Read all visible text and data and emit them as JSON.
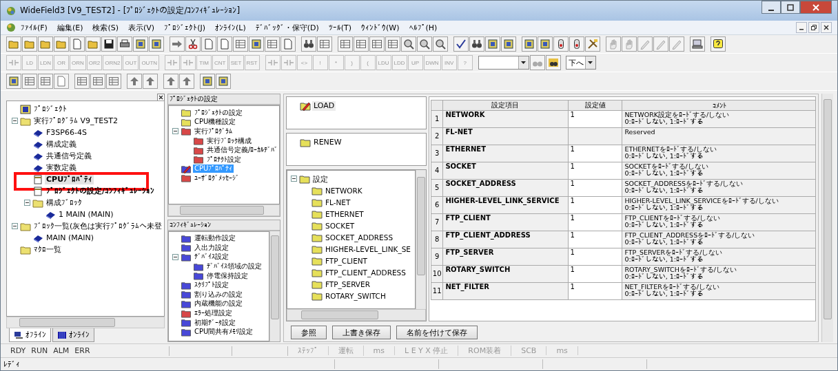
{
  "window": {
    "title": "WideField3 [V9_TEST2] - [ﾌﾟﾛｼﾞｪｸﾄの設定/ｺﾝﾌｨｷﾞｭﾚｰｼｮﾝ]"
  },
  "menu": [
    "ﾌｧｲﾙ(F)",
    "編集(E)",
    "検索(S)",
    "表示(V)",
    "ﾌﾟﾛｼﾞｪｸﾄ(J)",
    "ｵﾝﾗｲﾝ(L)",
    "ﾃﾞﾊﾞｯｸﾞ・保守(D)",
    "ﾂｰﾙ(T)",
    "ｳｨﾝﾄﾞｳ(W)",
    "ﾍﾙﾌﾟ(H)"
  ],
  "instruction_toolbar": [
    [
      {
        "kind": "icon",
        "disabled": true
      },
      {
        "kind": "text",
        "label": "LD",
        "disabled": true
      },
      {
        "kind": "text",
        "label": "LDN",
        "disabled": true
      },
      {
        "kind": "text",
        "label": "OR",
        "disabled": true
      },
      {
        "kind": "text",
        "label": "ORN",
        "disabled": true
      },
      {
        "kind": "text",
        "label": "OR2",
        "disabled": true
      },
      {
        "kind": "text",
        "label": "ORN2",
        "disabled": true
      },
      {
        "kind": "text",
        "label": "OUT",
        "disabled": true
      },
      {
        "kind": "text",
        "label": "OUTN",
        "disabled": true
      }
    ],
    [
      {
        "kind": "icon",
        "disabled": true
      },
      {
        "kind": "icon",
        "disabled": true
      },
      {
        "kind": "text",
        "label": "TIM",
        "disabled": true
      },
      {
        "kind": "text",
        "label": "CNT",
        "disabled": true
      },
      {
        "kind": "text",
        "label": "SET",
        "disabled": true
      },
      {
        "kind": "text",
        "label": "RST",
        "disabled": true
      }
    ],
    [
      {
        "kind": "icon",
        "disabled": true
      },
      {
        "kind": "icon",
        "disabled": true
      },
      {
        "kind": "text",
        "label": "<>",
        "disabled": true
      },
      {
        "kind": "text",
        "label": "!",
        "disabled": true
      },
      {
        "kind": "text",
        "label": "*",
        "disabled": true
      },
      {
        "kind": "text",
        "label": ")",
        "disabled": true
      },
      {
        "kind": "text",
        "label": "(",
        "disabled": true
      },
      {
        "kind": "text",
        "label": "LDU",
        "disabled": true
      },
      {
        "kind": "text",
        "label": "LDD",
        "disabled": true
      },
      {
        "kind": "text",
        "label": "UP",
        "disabled": true
      },
      {
        "kind": "text",
        "label": "DWN",
        "disabled": true
      },
      {
        "kind": "text",
        "label": "INV",
        "disabled": true
      },
      {
        "kind": "text",
        "label": "?",
        "disabled": true
      }
    ]
  ],
  "find": {
    "direction": "下へ"
  },
  "project_tree": {
    "items": [
      {
        "label": "ﾌﾟﾛｼﾞｪｸﾄ",
        "kind": "project",
        "bold": false,
        "selected": false,
        "marked": false
      },
      {
        "label": "実行ﾌﾟﾛｸﾞﾗﾑ V9_TEST2",
        "kind": "folder",
        "bold": false,
        "selected": false,
        "marked": false,
        "expanded": true,
        "children": [
          {
            "label": "F3SP66-4S",
            "kind": "book",
            "bold": false,
            "selected": false,
            "marked": false
          },
          {
            "label": "構成定義",
            "kind": "book",
            "bold": false,
            "selected": false,
            "marked": false
          },
          {
            "label": "共通信号定義",
            "kind": "book",
            "bold": false,
            "selected": false,
            "marked": false
          },
          {
            "label": "実数定義",
            "kind": "book",
            "bold": false,
            "selected": false,
            "marked": false
          },
          {
            "label": "CPUﾌﾟﾛﾊﾟﾃｨ",
            "kind": "doc",
            "bold": true,
            "selected": true,
            "marked": true
          },
          {
            "label": "ﾌﾟﾛｼﾞｪｸﾄの設定/ｺﾝﾌｨｷﾞｭﾚｰｼｮﾝ",
            "kind": "doc",
            "bold": true,
            "selected": false,
            "marked": false
          },
          {
            "label": "構成ﾌﾞﾛｯｸ",
            "kind": "folder",
            "bold": false,
            "selected": false,
            "marked": false,
            "expanded": true,
            "children": [
              {
                "label": "1 MAIN (MAIN)",
                "kind": "book",
                "bold": false,
                "selected": false,
                "marked": false
              }
            ]
          }
        ]
      },
      {
        "label": "ﾌﾞﾛｯｸ一覧(灰色は実行ﾌﾟﾛｸﾞﾗﾑへ未登",
        "kind": "folder",
        "bold": false,
        "selected": false,
        "marked": false,
        "expanded": true,
        "children": [
          {
            "label": "MAIN (MAIN)",
            "kind": "book",
            "bold": false,
            "selected": false,
            "marked": false
          }
        ]
      },
      {
        "label": "ﾏｸﾛ一覧",
        "kind": "folder",
        "bold": false,
        "selected": false,
        "marked": false
      }
    ]
  },
  "project_tabs": [
    {
      "label": "ｵﾌﾗｲﾝ",
      "selected": true
    },
    {
      "label": "ｵﾝﾗｲﾝ",
      "selected": false
    }
  ],
  "settings_panel": {
    "title": "ﾌﾟﾛｼﾞｪｸﾄの設定",
    "items": [
      {
        "label": "ﾌﾟﾛｼﾞｪｸﾄの設定",
        "kind": "folder",
        "color": "#e6e05a",
        "selected": false
      },
      {
        "label": "CPU機種設定",
        "kind": "folder",
        "color": "#e6e05a",
        "selected": false
      },
      {
        "label": "実行ﾌﾟﾛｸﾞﾗﾑ",
        "kind": "folder",
        "color": "#d84848",
        "selected": false,
        "expanded": true,
        "children": [
          {
            "label": "実行ﾌﾞﾛｯｸ構成",
            "kind": "folder",
            "color": "#d84848",
            "selected": false
          },
          {
            "label": "共通信号定義/ﾛｰｶﾙﾃﾞﾊﾞ",
            "kind": "folder",
            "color": "#d84848",
            "selected": false
          },
          {
            "label": "ﾌﾟﾛﾃｸﾄ設定",
            "kind": "folder",
            "color": "#d84848",
            "selected": false
          }
        ]
      },
      {
        "label": "CPUﾌﾟﾛﾊﾟﾃｨ",
        "kind": "pencil",
        "color": "#4848d8",
        "selected": true
      },
      {
        "label": "ﾕｰｻﾞﾛｸﾞﾒｯｾｰｼﾞ",
        "kind": "folder",
        "color": "#d84848",
        "selected": false
      }
    ]
  },
  "config_panel": {
    "title": "ｺﾝﾌｨｷﾞｭﾚｰｼｮﾝ",
    "items": [
      {
        "label": "運転動作設定",
        "kind": "folder",
        "color": "#4848d8",
        "selected": false
      },
      {
        "label": "入出力設定",
        "kind": "folder",
        "color": "#4848d8",
        "selected": false
      },
      {
        "label": "ﾃﾞﾊﾞｲｽ設定",
        "kind": "folder",
        "color": "#4848d8",
        "selected": false,
        "expanded": true,
        "children": [
          {
            "label": "ﾃﾞﾊﾞｲｽ領域の設定",
            "kind": "folder",
            "color": "#4848d8",
            "selected": false
          },
          {
            "label": "停電保持設定",
            "kind": "folder",
            "color": "#4848d8",
            "selected": false
          }
        ]
      },
      {
        "label": "ｽｸﾘﾌﾟﾄ設定",
        "kind": "folder",
        "color": "#4848d8",
        "selected": false
      },
      {
        "label": "割り込みの設定",
        "kind": "folder",
        "color": "#4848d8",
        "selected": false
      },
      {
        "label": "内蔵機能の設定",
        "kind": "folder",
        "color": "#4848d8",
        "selected": false
      },
      {
        "label": "ｴﾗｰ処理設定",
        "kind": "folder",
        "color": "#d84848",
        "selected": false
      },
      {
        "label": "初期ﾃﾞｰﾀ設定",
        "kind": "folder",
        "color": "#4848d8",
        "selected": false
      },
      {
        "label": "CPU間共有ﾒﾓﾘ設定",
        "kind": "folder",
        "color": "#4848d8",
        "selected": false
      }
    ]
  },
  "load_panel": {
    "items": [
      {
        "label": "LOAD",
        "kind": "pencil",
        "color": "#e6e05a",
        "selected": true
      }
    ]
  },
  "renew_panel": {
    "items": [
      {
        "label": "RENEW",
        "kind": "folder",
        "color": "#e6e05a",
        "selected": false
      }
    ]
  },
  "section_tree": {
    "items": [
      {
        "label": "設定",
        "kind": "folder",
        "color": "#e6e05a",
        "selected": false,
        "expanded": true,
        "children": [
          {
            "label": "NETWORK",
            "kind": "folder",
            "color": "#e6e05a",
            "selected": false
          },
          {
            "label": "FL-NET",
            "kind": "folder",
            "color": "#e6e05a",
            "selected": false
          },
          {
            "label": "ETHERNET",
            "kind": "folder",
            "color": "#e6e05a",
            "selected": false
          },
          {
            "label": "SOCKET",
            "kind": "folder",
            "color": "#e6e05a",
            "selected": false
          },
          {
            "label": "SOCKET_ADDRESS",
            "kind": "folder",
            "color": "#e6e05a",
            "selected": false
          },
          {
            "label": "HIGHER-LEVEL_LINK_SE",
            "kind": "folder",
            "color": "#e6e05a",
            "selected": false
          },
          {
            "label": "FTP_CLIENT",
            "kind": "folder",
            "color": "#e6e05a",
            "selected": false
          },
          {
            "label": "FTP_CLIENT_ADDRESS",
            "kind": "folder",
            "color": "#e6e05a",
            "selected": false
          },
          {
            "label": "FTP_SERVER",
            "kind": "folder",
            "color": "#e6e05a",
            "selected": false
          },
          {
            "label": "ROTARY_SWITCH",
            "kind": "folder",
            "color": "#e6e05a",
            "selected": false
          }
        ]
      }
    ]
  },
  "buttons": [
    "参照",
    "上書き保存",
    "名前を付けて保存"
  ],
  "table": {
    "columns": [
      "設定項目",
      "設定値",
      "ｺﾒﾝﾄ"
    ],
    "rows": [
      {
        "index": "1",
        "name": "NETWORK",
        "value": "1",
        "disabled": false,
        "comment": [
          "NETWORK設定をﾛｰﾄﾞする/しない",
          "0:ﾛｰﾄﾞしない, 1:ﾛｰﾄﾞする"
        ]
      },
      {
        "index": "2",
        "name": "FL-NET",
        "disabled": true,
        "comment": [
          "Reserved"
        ]
      },
      {
        "index": "3",
        "name": "ETHERNET",
        "value": "1",
        "disabled": false,
        "comment": [
          "ETHERNETをﾛｰﾄﾞする/しない",
          "0:ﾛｰﾄﾞしない, 1:ﾛｰﾄﾞする"
        ]
      },
      {
        "index": "4",
        "name": "SOCKET",
        "value": "1",
        "disabled": false,
        "comment": [
          "SOCKETをﾛｰﾄﾞする/しない",
          "0:ﾛｰﾄﾞしない, 1:ﾛｰﾄﾞする"
        ]
      },
      {
        "index": "5",
        "name": "SOCKET_ADDRESS",
        "value": "1",
        "disabled": false,
        "comment": [
          "SOCKET_ADDRESSをﾛｰﾄﾞする/しない",
          "0:ﾛｰﾄﾞしない, 1:ﾛｰﾄﾞする"
        ]
      },
      {
        "index": "6",
        "name": "HIGHER-LEVEL_LINK_SERVICE",
        "value": "1",
        "disabled": false,
        "comment": [
          "HIGHER-LEVEL_LINK_SERVICEをﾛｰﾄﾞする/しない",
          "0:ﾛｰﾄﾞしない, 1:ﾛｰﾄﾞする"
        ]
      },
      {
        "index": "7",
        "name": "FTP_CLIENT",
        "value": "1",
        "disabled": false,
        "comment": [
          "FTP_CLIENTをﾛｰﾄﾞする/しない",
          "0:ﾛｰﾄﾞしない, 1:ﾛｰﾄﾞする"
        ]
      },
      {
        "index": "8",
        "name": "FTP_CLIENT_ADDRESS",
        "value": "1",
        "disabled": false,
        "comment": [
          "FTP_CLIENT_ADDRESSをﾛｰﾄﾞする/しない",
          "0:ﾛｰﾄﾞしない, 1:ﾛｰﾄﾞする"
        ]
      },
      {
        "index": "9",
        "name": "FTP_SERVER",
        "value": "1",
        "disabled": false,
        "comment": [
          "FTP_SERVERをﾛｰﾄﾞする/しない",
          "0:ﾛｰﾄﾞしない, 1:ﾛｰﾄﾞする"
        ]
      },
      {
        "index": "10",
        "name": "ROTARY_SWITCH",
        "value": "1",
        "disabled": false,
        "comment": [
          "ROTARY_SWITCHをﾛｰﾄﾞする/しない",
          "0:ﾛｰﾄﾞしない, 1:ﾛｰﾄﾞする"
        ]
      },
      {
        "index": "11",
        "name": "NET_FILTER",
        "value": "1",
        "disabled": false,
        "comment": [
          "NET_FILTERをﾛｰﾄﾞする/しない",
          "0:ﾛｰﾄﾞしない, 1:ﾛｰﾄﾞする"
        ]
      }
    ]
  },
  "status_bar": {
    "indicators": [
      "RDY",
      "RUN",
      "ALM",
      "ERR"
    ],
    "fields": [
      "ｽﾃｯﾌﾟ",
      "運転",
      "ms",
      "L E Y X 停止",
      "ROM装着",
      "SCB",
      "ms"
    ]
  },
  "message": "ﾚﾃﾞｨ"
}
